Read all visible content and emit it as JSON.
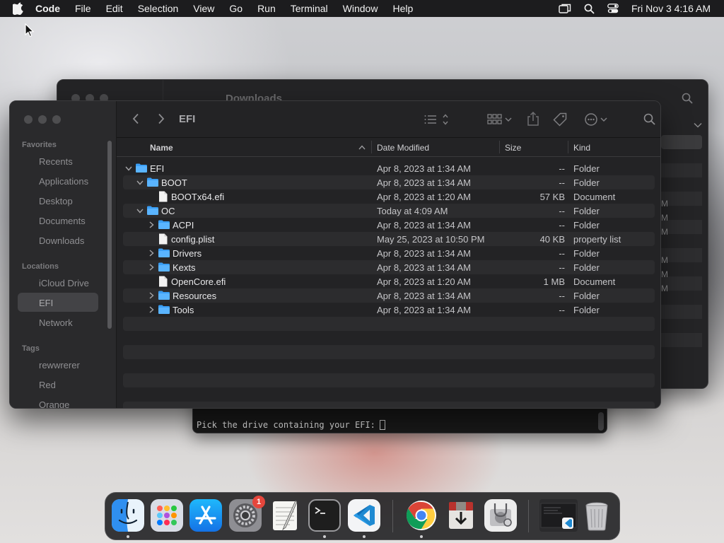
{
  "menubar": {
    "app_name": "Code",
    "items": [
      "File",
      "Edit",
      "Selection",
      "View",
      "Go",
      "Run",
      "Terminal",
      "Window",
      "Help"
    ],
    "clock": "Fri Nov 3  4:16 AM"
  },
  "back_window": {
    "title": "Downloads",
    "right_marks": [
      "M",
      "M",
      "M",
      "M",
      "M",
      "M"
    ]
  },
  "terminal": {
    "prompt": "Pick the drive containing your EFI:"
  },
  "finder": {
    "path_title": "EFI",
    "sidebar": {
      "favorites_header": "Favorites",
      "favorites": [
        "Recents",
        "Applications",
        "Desktop",
        "Documents",
        "Downloads"
      ],
      "locations_header": "Locations",
      "locations": [
        "iCloud Drive",
        "EFI",
        "Network"
      ],
      "tags_header": "Tags",
      "tags": [
        "rewwrerer",
        "Red",
        "Orange"
      ]
    },
    "columns": {
      "name": "Name",
      "date": "Date Modified",
      "size": "Size",
      "kind": "Kind"
    },
    "rows": [
      {
        "name": "EFI",
        "date": "Apr 8, 2023 at 1:34 AM",
        "size": "--",
        "kind": "Folder"
      },
      {
        "name": "BOOT",
        "date": "Apr 8, 2023 at 1:34 AM",
        "size": "--",
        "kind": "Folder"
      },
      {
        "name": "BOOTx64.efi",
        "date": "Apr 8, 2023 at 1:20 AM",
        "size": "57 KB",
        "kind": "Document"
      },
      {
        "name": "OC",
        "date": "Today at 4:09 AM",
        "size": "--",
        "kind": "Folder"
      },
      {
        "name": "ACPI",
        "date": "Apr 8, 2023 at 1:34 AM",
        "size": "--",
        "kind": "Folder"
      },
      {
        "name": "config.plist",
        "date": "May 25, 2023 at 10:50 PM",
        "size": "40 KB",
        "kind": "property list"
      },
      {
        "name": "Drivers",
        "date": "Apr 8, 2023 at 1:34 AM",
        "size": "--",
        "kind": "Folder"
      },
      {
        "name": "Kexts",
        "date": "Apr 8, 2023 at 1:34 AM",
        "size": "--",
        "kind": "Folder"
      },
      {
        "name": "OpenCore.efi",
        "date": "Apr 8, 2023 at 1:20 AM",
        "size": "1 MB",
        "kind": "Document"
      },
      {
        "name": "Resources",
        "date": "Apr 8, 2023 at 1:34 AM",
        "size": "--",
        "kind": "Folder"
      },
      {
        "name": "Tools",
        "date": "Apr 8, 2023 at 1:34 AM",
        "size": "--",
        "kind": "Folder"
      }
    ]
  },
  "dock": {
    "apps": [
      "finder-icon",
      "launchpad-icon",
      "app-store-icon",
      "system-settings-icon",
      "textedit-icon",
      "terminal-icon",
      "vscode-icon",
      "chrome-icon",
      "installer-icon",
      "disk-utility-icon",
      "window-thumbnail-icon",
      "trash-icon"
    ],
    "settings_badge": "1"
  },
  "colors": {
    "folder": "#3a9ef5",
    "window_bg": "#232325",
    "menubar_bg": "#1c1c1e"
  }
}
